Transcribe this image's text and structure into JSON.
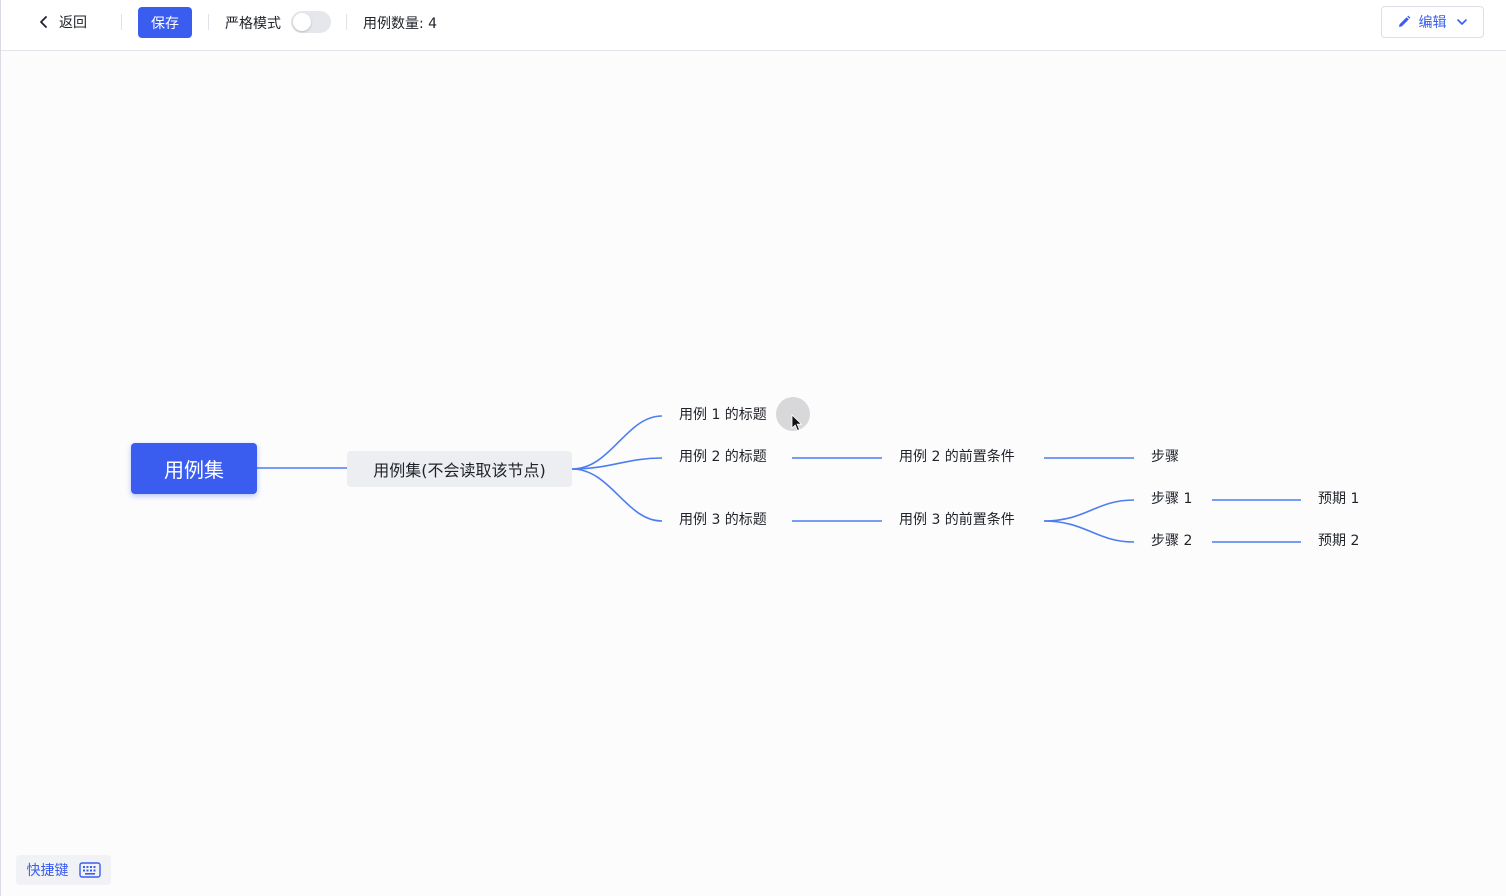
{
  "toolbar": {
    "back_label": "返回",
    "save_label": "保存",
    "strict_mode_label": "严格模式",
    "strict_mode_on": false,
    "case_count_label": "用例数量: 4",
    "edit_label": "编辑"
  },
  "mindmap": {
    "root": "用例集",
    "suite": "用例集(不会读取该节点)",
    "case1_title": "用例 1 的标题",
    "case2_title": "用例 2 的标题",
    "case2_precondition": "用例 2 的前置条件",
    "case2_step": "步骤",
    "case3_title": "用例 3 的标题",
    "case3_precondition": "用例 3 的前置条件",
    "case3_step1": "步骤 1",
    "case3_expect1": "预期 1",
    "case3_step2": "步骤 2",
    "case3_expect2": "预期 2"
  },
  "footer": {
    "shortcut_label": "快捷键"
  },
  "colors": {
    "accent": "#3a5df0",
    "link_line": "#4d7ef0"
  }
}
